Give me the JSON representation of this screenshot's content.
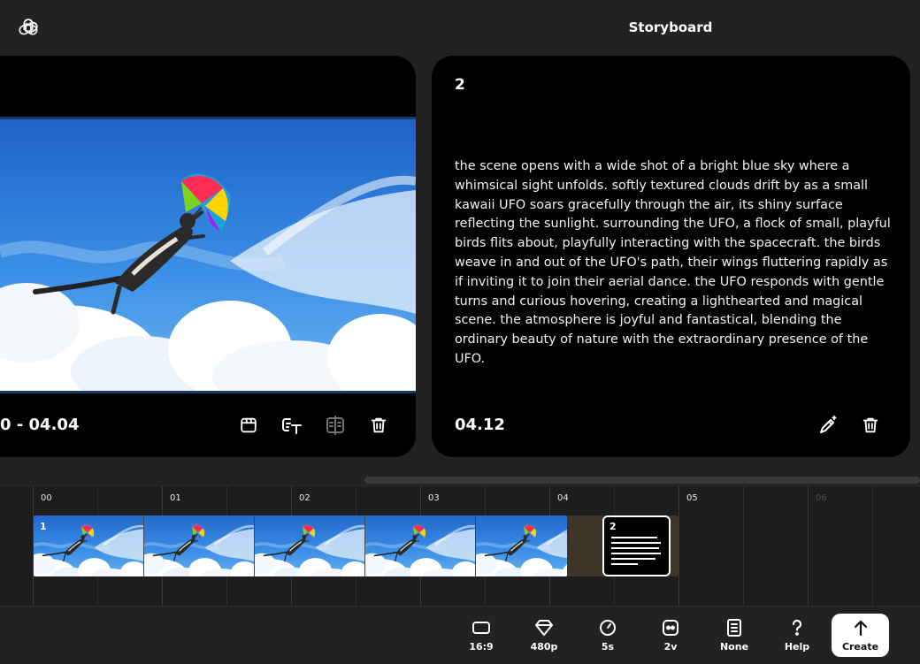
{
  "header": {
    "title": "Storyboard"
  },
  "scenes": [
    {
      "time_range": "0 - 04.04"
    },
    {
      "number": "2",
      "prompt": "the scene opens with a wide shot of a bright blue sky where a whimsical sight unfolds. softly textured clouds drift by as a small kawaii UFO soars gracefully through the air, its shiny surface reflecting the sunlight. surrounding the UFO, a flock of small, playful birds flits about, playfully interacting with the spacecraft. the birds weave in and out of the UFO's path, their wings fluttering rapidly as if inviting it to join their aerial dance. the UFO responds with gentle turns and curious hovering, creating a lighthearted and magical scene. the atmosphere is joyful and fantastical, blending the ordinary beauty of nature with the extraordinary presence of the UFO.",
      "time": "04.12"
    }
  ],
  "timeline": {
    "labels": [
      "00",
      "01",
      "02",
      "03",
      "04",
      "05",
      "06"
    ],
    "clips": [
      {
        "number": "1"
      },
      {
        "number": "2"
      }
    ]
  },
  "toolbar": {
    "aspect_label": "16:9",
    "resolution_label": "480p",
    "duration_label": "5s",
    "variations_label": "2v",
    "preset_label": "None",
    "help_label": "Help",
    "create_label": "Create"
  },
  "icons": {
    "logo": "openai-logo-icon",
    "scene1": [
      "storyboard-card-icon",
      "edit-text-icon",
      "compare-icon",
      "trash-icon"
    ],
    "scene2": [
      "magic-pen-icon",
      "trash-icon"
    ],
    "toolbar": [
      "aspect-ratio-icon",
      "diamond-icon",
      "clock-icon",
      "variations-icon",
      "preset-icon",
      "help-icon",
      "arrow-up-icon"
    ]
  }
}
